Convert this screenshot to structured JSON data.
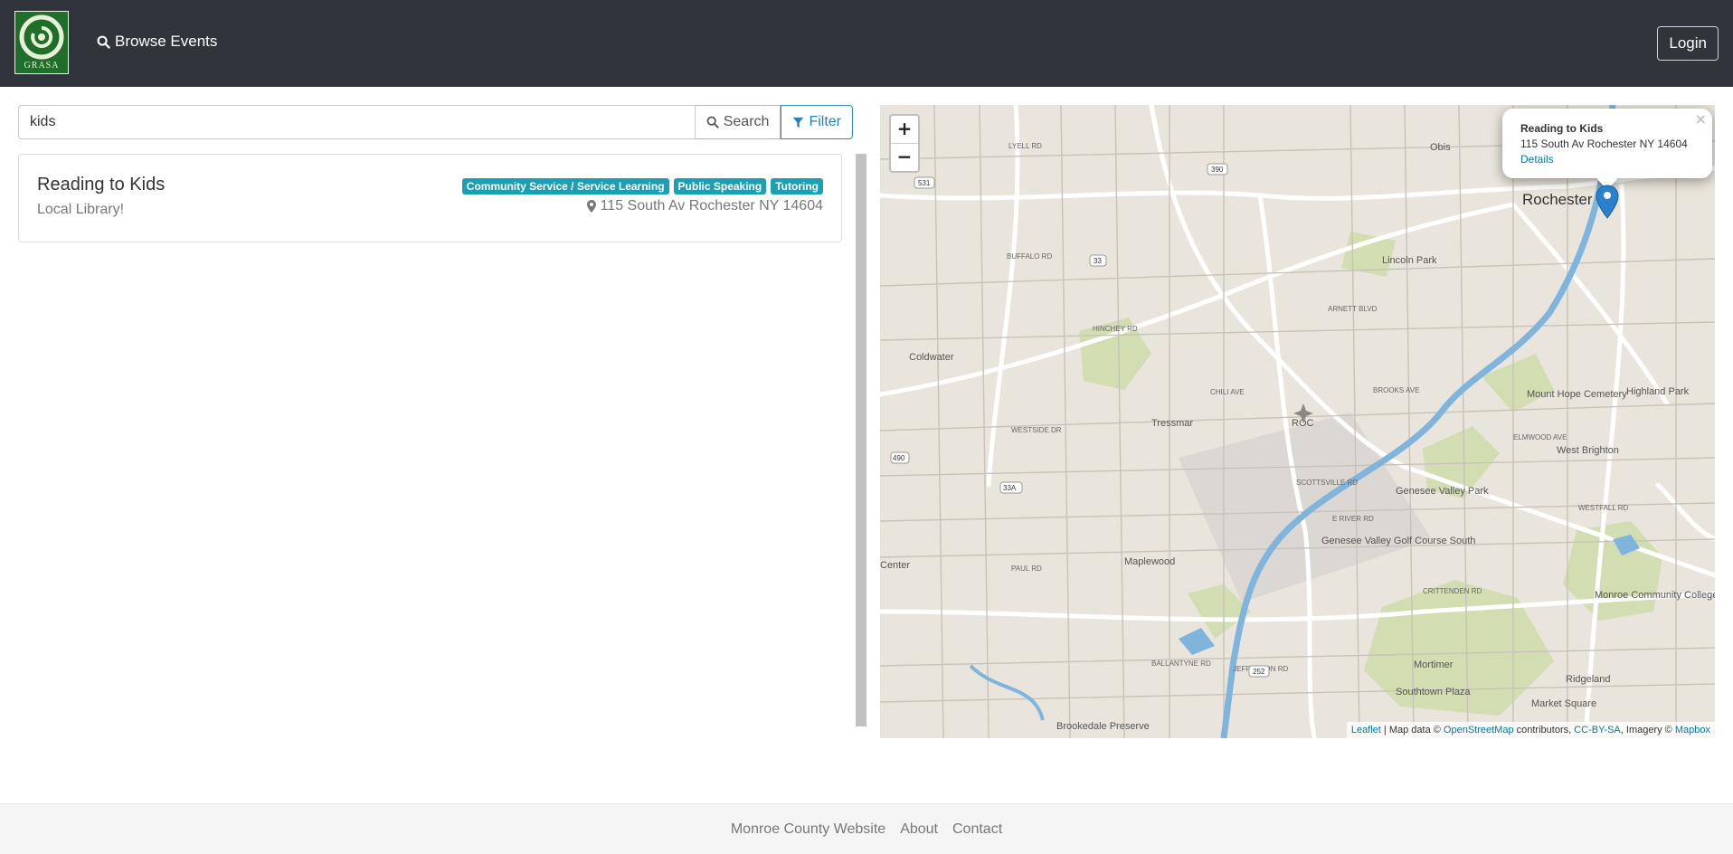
{
  "navbar": {
    "logo_text": "GRASA",
    "browse_label": "Browse Events",
    "login_label": "Login"
  },
  "search": {
    "query": "kids",
    "search_label": "Search",
    "filter_label": "Filter"
  },
  "results": [
    {
      "title": "Reading to Kids",
      "subtitle": "Local Library!",
      "tags": [
        "Community Service / Service Learning",
        "Public Speaking",
        "Tutoring"
      ],
      "address": "115 South Av Rochester NY 14604"
    }
  ],
  "map": {
    "zoom_in": "+",
    "zoom_out": "−",
    "labels": {
      "rochester": "Rochester",
      "coldwater": "Coldwater",
      "tressmar": "Tressmar",
      "roc": "ROC",
      "lincoln_park": "Lincoln Park",
      "maplewood": "Maplewood",
      "mount_hope": "Mount Hope Cemetery",
      "highland_park": "Highland Park",
      "west_brighton": "West Brighton",
      "genesee_valley_park": "Genesee Valley Park",
      "golf_course": "Genesee Valley Golf Course South",
      "monroe_cc": "Monroe Community College",
      "mortimer": "Mortimer",
      "southtown": "Southtown Plaza",
      "market_square": "Market Square",
      "ridgeland": "Ridgeland",
      "brookedale": "Brookedale Preserve",
      "center": "Center",
      "obis": "Obis",
      "buffalo_rd": "BUFFALO RD",
      "brooks_ave": "BROOKS AVE",
      "chili_ave": "CHILI AVE",
      "hinchey_rd": "HINCHEY RD",
      "lyell_rd": "LYELL RD",
      "scottsville_rd": "SCOTTSVILLE RD",
      "e_river_rd": "E RIVER RD",
      "crittenden_rd": "CRITTENDEN RD",
      "ballantyne_rd": "BALLANTYNE RD",
      "jefferson_rd": "JEFFERSON RD",
      "arnett_blvd": "ARNETT BLVD",
      "elmwood_ave": "ELMWOOD AVE",
      "westfall_rd": "WESTFALL RD",
      "paul_rd": "PAUL RD",
      "westside_dr": "WESTSIDE DR",
      "route_390": "390",
      "route_531": "531",
      "route_490": "490",
      "route_33": "33",
      "route_33a": "33A",
      "route_252": "252"
    },
    "popup": {
      "title": "Reading to Kids",
      "address": "115 South Av Rochester NY 14604",
      "link": "Details",
      "close": "×"
    },
    "attribution": {
      "leaflet": "Leaflet",
      "sep1": " | Map data © ",
      "osm": "OpenStreetMap",
      "sep2": " contributors, ",
      "ccbysa": "CC-BY-SA",
      "sep3": ", Imagery © ",
      "mapbox": "Mapbox"
    },
    "colors": {
      "water": "#7fb4dc",
      "park": "#c9dba3",
      "road": "#ffffff",
      "marker": "#2a81cb"
    }
  },
  "footer": {
    "links": [
      "Monroe County Website",
      "About",
      "Contact"
    ]
  }
}
